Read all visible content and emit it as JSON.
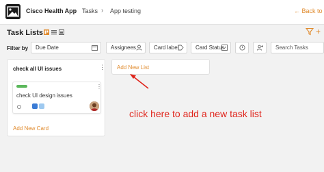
{
  "header": {
    "app_name": "Cisco Health App",
    "breadcrumb": [
      "Tasks",
      "App testing"
    ],
    "back_link": "← Back to all"
  },
  "page": {
    "title": "Task Lists"
  },
  "filters": {
    "label": "Filter by",
    "due_date": "Due Date",
    "assignees": "Assignees",
    "card_label": "Card label",
    "card_status": "Card Status",
    "search_placeholder": "Search Tasks"
  },
  "board": {
    "lists": [
      {
        "title": "check all UI issues",
        "cards": [
          {
            "title": "check UI design issues",
            "tag_color": "#5cb85c"
          }
        ],
        "add_card_label": "Add New Card"
      }
    ],
    "add_list_label": "Add New List"
  },
  "annotation": {
    "text": "click here to add a new task list",
    "color": "#e0241b"
  },
  "colors": {
    "accent": "#e08a2c",
    "annotation": "#e0241b"
  }
}
